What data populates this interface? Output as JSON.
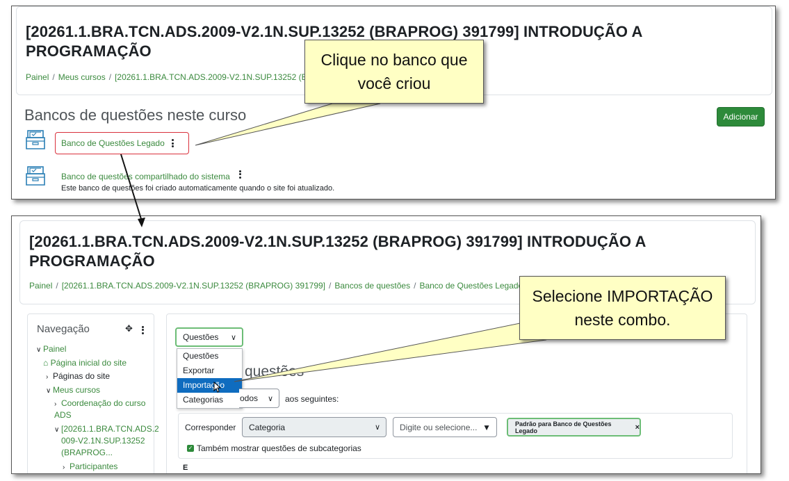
{
  "top": {
    "course_title_line1": "[20261.1.BRA.TCN.ADS.2009-V2.1N.SUP.13252 (BRAPROG) 391799] INTRODUÇÃO A",
    "course_title_line2": "PROGRAMAÇÃO",
    "breadcrumb": [
      "Painel",
      "Meus cursos",
      "[20261.1.BRA.TCN.ADS.2009-V2.1N.SUP.13252 (BRAP"
    ],
    "section_heading": "Bancos de questões neste curso",
    "add_button": "Adicionar",
    "banks": [
      {
        "label": "Banco de Questões Legado",
        "description": ""
      },
      {
        "label": "Banco de questões compartilhado do sistema",
        "description": "Este banco de questões foi criado automaticamente quando o site foi atualizado."
      }
    ]
  },
  "bottom": {
    "course_title_line1": "[20261.1.BRA.TCN.ADS.2009-V2.1N.SUP.13252 (BRAPROG) 391799] INTRODUÇÃO A",
    "course_title_line2": "PROGRAMAÇÃO",
    "breadcrumb": [
      "Painel",
      "[20261.1.BRA.TCN.ADS.2009-V2.1N.SUP.13252 (BRAPROG) 391799]",
      "Bancos de questões",
      "Banco de Questões Legado"
    ],
    "nav": {
      "title": "Navegação",
      "items": [
        "Painel",
        "Página inicial do site",
        "Páginas do site",
        "Meus cursos",
        "Coordenação do curso",
        "ADS",
        "[20261.1.BRA.TCN.ADS.2",
        "009-V2.1N.SUP.13252",
        "(BRAPROG...",
        "Participantes"
      ]
    },
    "combo": {
      "selected": "Questões",
      "options": [
        "Questões",
        "Exportar",
        "Importação",
        "Categorias"
      ],
      "highlighted": "Importação"
    },
    "heading_partial": "questões",
    "filter": {
      "todos_select": "odos",
      "seguintes": "aos seguintes:",
      "corresponder": "Corresponder",
      "categoria_select": "Categoria",
      "search_placeholder": "Digite ou selecione...",
      "pill": "Padrão para Banco de Questões Legado",
      "pill_close": "×",
      "checkbox_label": "Também mostrar questões de subcategorias",
      "letter_e": "E"
    }
  },
  "callouts": {
    "first_line1": "Clique no banco que",
    "first_line2": "você criou",
    "second_line1": "Selecione IMPORTAÇÃO",
    "second_line2": "neste combo."
  },
  "colors": {
    "link_green": "#3b8a3e",
    "button_green": "#2d8a3a",
    "highlight_red": "#d9303c",
    "callout_yellow": "#ffffc4",
    "select_blue": "#0f6cbf"
  }
}
